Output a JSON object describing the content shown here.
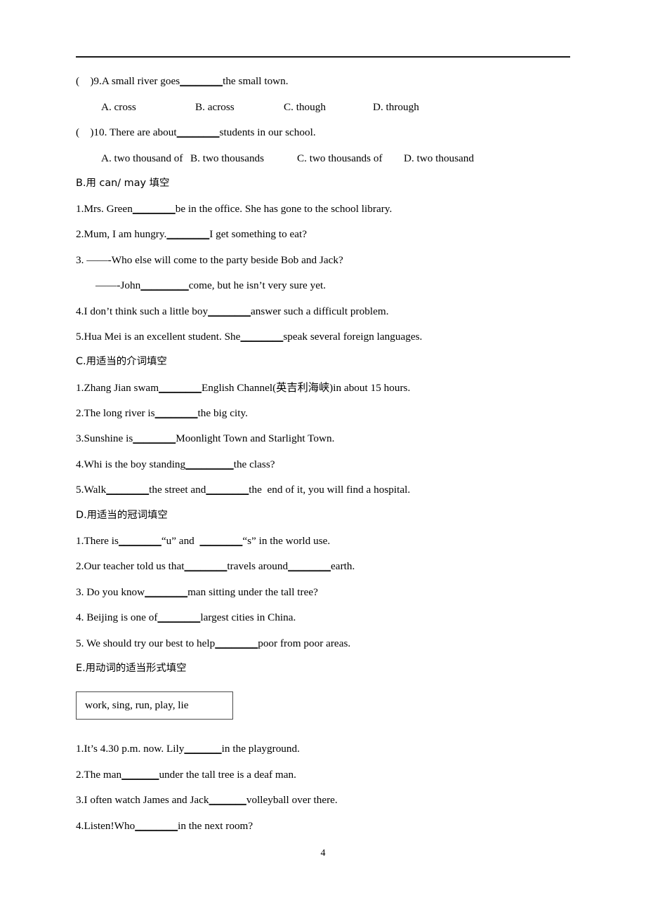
{
  "document": {
    "page_number": "4",
    "header_rule": true
  },
  "section_a_tail": {
    "questions": [
      {
        "marker": "(    )9.",
        "stem_before": "A small river goes",
        "blank": "________",
        "stem_after": "the small town.",
        "options": [
          "A. cross",
          "B. across",
          "C. though",
          "D. through"
        ]
      },
      {
        "marker": "(    )10.",
        "stem_before": " There are about",
        "blank": "________",
        "stem_after": "students in our school.",
        "options": [
          "A. two thousand of",
          "B. two thousands",
          "C. two thousands of",
          "D. two thousand"
        ]
      }
    ]
  },
  "section_b": {
    "heading": "B.用 can/ may 填空",
    "items": [
      {
        "num": "1.",
        "before": "Mrs. Green",
        "blank": "________",
        "after": "be in the office. She has gone to the school library."
      },
      {
        "num": "2.",
        "before": "Mum, I am hungry.",
        "blank": "________",
        "after": "I get something to eat?"
      },
      {
        "num": "3. ",
        "before": "——-Who else will come to the party beside Bob and Jack?",
        "blank": "",
        "after": ""
      },
      {
        "num": "",
        "before": "——-John",
        "blank": "_________",
        "after": "come, but he isn’t very sure yet.",
        "indent": true
      },
      {
        "num": "4.",
        "before": "I don’t think such a little boy",
        "blank": "________",
        "after": "answer such a difficult problem."
      },
      {
        "num": "5.",
        "before": "Hua Mei is an excellent student. She",
        "blank": "________",
        "after": "speak several foreign languages."
      }
    ]
  },
  "section_c": {
    "heading": "C.用适当的介词填空",
    "items": [
      {
        "num": "1.",
        "before": "Zhang Jian swam",
        "blank": "________",
        "after": "English Channel(英吉利海峡)in about 15 hours."
      },
      {
        "num": "2.",
        "before": "The long river is",
        "blank": "________",
        "after": "the big city."
      },
      {
        "num": "3.",
        "before": "Sunshine is",
        "blank": "________",
        "after": "Moonlight Town and Starlight Town."
      },
      {
        "num": "4.",
        "before": "Whi is the boy standing",
        "blank": "_________",
        "after": "the class?"
      },
      {
        "num": "5.",
        "before": "Walk",
        "blank": "________",
        "mid": "the street and",
        "blank2": "________",
        "after": "the  end of it, you will find a hospital."
      }
    ]
  },
  "section_d": {
    "heading": "D.用适当的冠词填空",
    "items": [
      {
        "num": "1.",
        "before": "There is",
        "blank": "________",
        "mid": "“u” and  ",
        "blank2": "________",
        "after": "“s” in the world use."
      },
      {
        "num": "2.",
        "before": "Our teacher told us that",
        "blank": "________",
        "mid": "travels around",
        "blank2": "________",
        "after": "earth."
      },
      {
        "num": "3. ",
        "before": "Do you know",
        "blank": "________",
        "after": "man sitting under the tall tree?"
      },
      {
        "num": "4. ",
        "before": "Beijing is one of",
        "blank": "________",
        "after": "largest cities in China."
      },
      {
        "num": "5. ",
        "before": "We should try our best to help",
        "blank": "________",
        "after": "poor from poor areas."
      }
    ]
  },
  "section_e": {
    "heading": "E.用动词的适当形式填空",
    "word_bank": "work, sing, run, play, lie",
    "items": [
      {
        "num": "1.",
        "before": "It’s 4.30 p.m. now. Lily",
        "blank": "_______",
        "after": "in the playground."
      },
      {
        "num": "2.",
        "before": "The man",
        "blank": "_______",
        "after": "under the tall tree is a deaf man."
      },
      {
        "num": "3.",
        "before": "I often watch James and Jack",
        "blank": "_______",
        "after": "volleyball over there."
      },
      {
        "num": "4.",
        "before": "Listen!Who",
        "blank": "________",
        "after": "in the next room?"
      }
    ]
  }
}
